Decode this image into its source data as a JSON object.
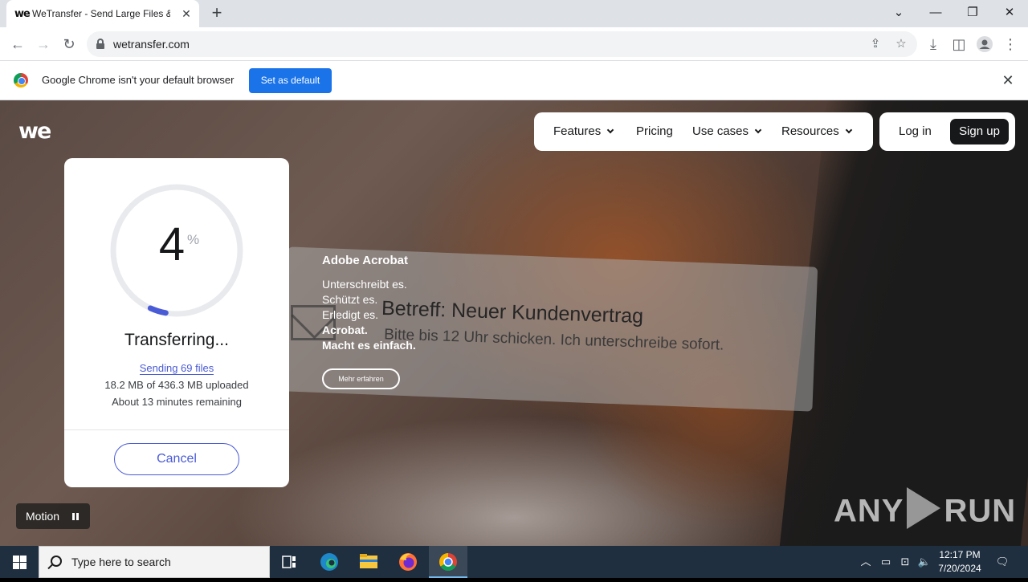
{
  "browser": {
    "tab_title": "WeTransfer - Send Large Files &",
    "tab_favicon": "we",
    "new_tab_symbol": "+",
    "url": "wetransfer.com",
    "infobar": {
      "message": "Google Chrome isn't your default browser",
      "button": "Set as default"
    }
  },
  "site": {
    "logo": "we",
    "nav": {
      "features": "Features",
      "pricing": "Pricing",
      "use_cases": "Use cases",
      "resources": "Resources"
    },
    "login": "Log in",
    "signup": "Sign up"
  },
  "transfer": {
    "percent": 4,
    "percent_label": "4",
    "percent_sign": "%",
    "status": "Transferring...",
    "sending": "Sending 69 files",
    "uploaded": "18.2 MB of 436.3 MB uploaded",
    "remaining": "About 13 minutes remaining",
    "cancel": "Cancel"
  },
  "ad": {
    "brand": "Adobe Acrobat",
    "lines": [
      "Unterschreibt es.",
      "Schützt es.",
      "Erledigt es.",
      "Acrobat.",
      "Macht es einfach."
    ],
    "button": "Mehr erfahren",
    "email_subject": "Betreff: Neuer Kundenvertrag",
    "email_body": "Bitte bis 12 Uhr schicken. Ich unterschreibe sofort."
  },
  "motion": {
    "label": "Motion"
  },
  "watermark": {
    "left": "ANY",
    "right": "RUN"
  },
  "taskbar": {
    "search_placeholder": "Type here to search",
    "time": "12:17 PM",
    "date": "7/20/2024"
  },
  "colors": {
    "accent_blue": "#4a5bd6",
    "chrome_blue": "#1a73e8",
    "dark": "#17181a",
    "progress_track": "#e8eaed"
  }
}
